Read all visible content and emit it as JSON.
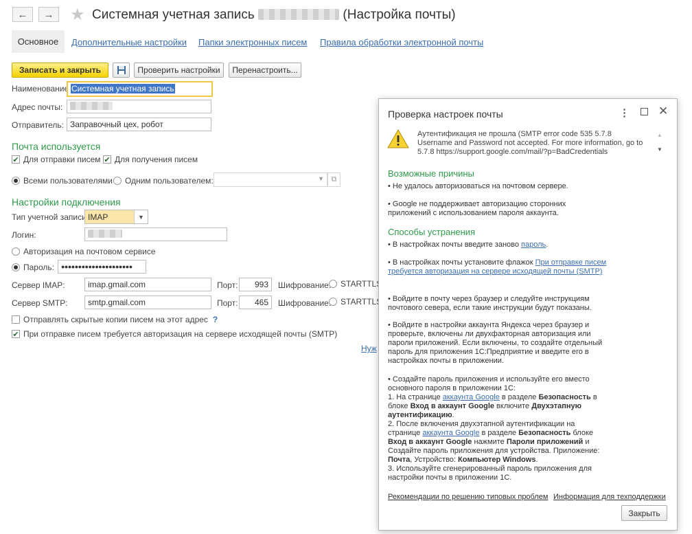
{
  "window": {
    "title_prefix": "Системная учетная запись",
    "title_suffix": "(Настройка почты)"
  },
  "tabs": [
    {
      "label": "Основное"
    },
    {
      "label": "Дополнительные настройки"
    },
    {
      "label": "Папки электронных писем"
    },
    {
      "label": "Правила обработки электронной почты"
    }
  ],
  "toolbar": {
    "save_close": "Записать и закрыть",
    "check_settings": "Проверить настройки",
    "reconfigure": "Перенастроить..."
  },
  "form": {
    "name_label": "Наименование:",
    "name_value": "Системная учетная запись",
    "email_label": "Адрес почты:",
    "sender_label": "Отправитель:",
    "sender_value": "Заправочный цех, робот",
    "usage_header": "Почта используется",
    "for_sending": "Для отправки писем",
    "for_receiving": "Для получения писем",
    "all_users": "Всеми пользователями",
    "one_user": "Одним пользователем:",
    "connection_header": "Настройки подключения",
    "account_type_label": "Тип учетной записи:",
    "account_type_value": "IMAP",
    "login_label": "Логин:",
    "auth_service": "Авторизация на почтовом сервисе",
    "password_label": "Пароль:",
    "password_value": "●●●●●●●●●●●●●●●●●●●●●",
    "imap_label": "Сервер IMAP:",
    "imap_value": "imap.gmail.com",
    "smtp_label": "Сервер SMTP:",
    "smtp_value": "smtp.gmail.com",
    "port_label": "Порт:",
    "imap_port": "993",
    "smtp_port": "465",
    "encryption_label": "Шифрование:",
    "starttls": "STARTTLS",
    "hidden_copies": "Отправлять скрытые копии писем на этот адрес",
    "help_mark": "?",
    "smtp_auth": "При отправке писем требуется авторизация на сервере исходящей почты (SMTP)",
    "cut_link": "Нуж"
  },
  "dialog": {
    "title": "Проверка настроек почты",
    "error_text": "Аутентификация не прошла (SMTP error code 535 5.7.8 Username and Password not accepted. For more information, go to 5.7.8  https://support.google.com/mail/?p=BadCredentials",
    "causes_header": "Возможные причины",
    "cause1": "• Не удалось авторизоваться на почтовом сервере.",
    "cause2": "• Google не поддерживает авторизацию сторонних приложений с использованием пароля аккаунта.",
    "fix_header": "Способы устранения",
    "fix1_pre": "• В настройках почты введите заново ",
    "fix1_link": "пароль",
    "fix1_post": ".",
    "fix2_pre": "• В настройках почты установите флажок ",
    "fix2_link": "При отправке писем требуется авторизация на сервере исходящей почты (SMTP)",
    "fix3": "• Войдите в почту через браузер и следуйте инструкциям почтового севера, если такие инструкции будут показаны.",
    "fix4": "• Войдите в настройки аккаунта Яндекса через браузер и проверьте, включены ли двухфакторная авторизация или пароли приложений. Если включены, то создайте отдельный пароль для приложения 1С:Предприятие и введите его в настройках почты в приложении.",
    "fix5_intro": "• Создайте пароль приложения и используйте его вместо основного пароля в приложении 1С:",
    "step1_a": "1. На странице ",
    "step1_link": "аккаунта Google",
    "step1_b": " в разделе ",
    "step1_bold1": "Безопасность",
    "step1_c": " в блоке ",
    "step1_bold2": "Вход в аккаунт Google",
    "step1_d": " включите ",
    "step1_bold3": "Двухэтапную аутентификацию",
    "step1_e": ".",
    "step2_a": "2. После включения двухэтапной аутентификации на странице ",
    "step2_link": "аккаунта Google",
    "step2_b": " в разделе ",
    "step2_bold1": "Безопасность",
    "step2_c": " блоке ",
    "step2_bold2": "Вход в аккаунт Google",
    "step2_d": " нажмите ",
    "step2_bold3": "Пароли приложений",
    "step2_e": " и Создайте пароль приложения для устройства. Приложение: ",
    "step2_bold4": "Почта",
    "step2_f": ", Устройство: ",
    "step2_bold5": "Компьютер Windows",
    "step2_g": ".",
    "step3": "3. Используйте сгенерированный пароль приложения для настройки почты в приложении 1С.",
    "footer_link1": "Рекомендации по решению типовых проблем",
    "footer_link2": "Информация для техподдержки",
    "close_btn": "Закрыть"
  }
}
